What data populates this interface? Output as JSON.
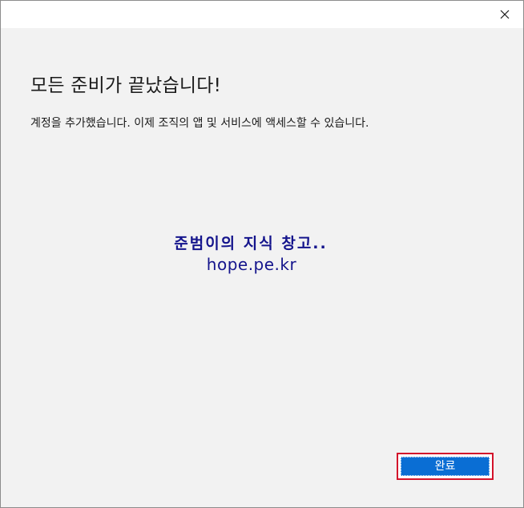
{
  "dialog": {
    "heading": "모든 준비가 끝났습니다!",
    "description": "계정을 추가했습니다. 이제 조직의 앱 및 서비스에 액세스할 수 있습니다.",
    "close_icon": "close-icon",
    "finish_label": "완료"
  },
  "watermark": {
    "line1": "준범이의 지식 창고..",
    "line2": "hope.pe.kr"
  },
  "colors": {
    "accent": "#0a6ed4",
    "highlight_border": "#d3132b",
    "watermark": "#14148c"
  }
}
